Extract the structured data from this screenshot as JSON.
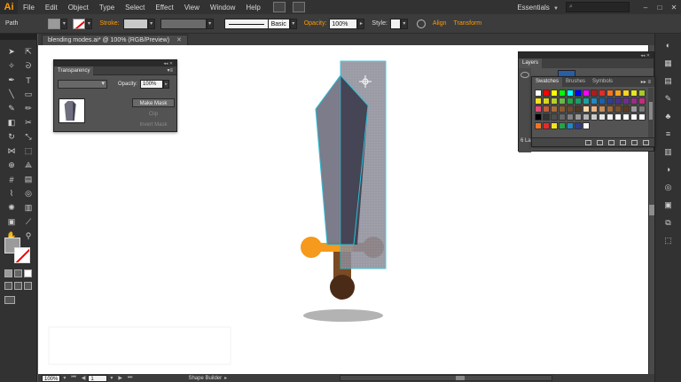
{
  "app": {
    "logo": "Ai"
  },
  "menu": {
    "items": [
      "File",
      "Edit",
      "Object",
      "Type",
      "Select",
      "Effect",
      "View",
      "Window",
      "Help"
    ]
  },
  "topbar": {
    "workspace": "Essentials",
    "search_placeholder": ""
  },
  "control_bar": {
    "selection_label": "Path",
    "stroke_label": "Stroke:",
    "stroke_profile": "Basic",
    "opacity_label": "Opacity:",
    "opacity_value": "100%",
    "style_label": "Style:",
    "align_label": "Align",
    "transform_label": "Transform"
  },
  "document": {
    "tab_title": "blending modes.ai* @ 100% (RGB/Preview)"
  },
  "transparency_panel": {
    "title": "Transparency",
    "opacity_label": "Opacity:",
    "opacity_value": "100%",
    "make_mask_label": "Make Mask",
    "clip_label": "Clip",
    "invert_mask_label": "Invert Mask"
  },
  "layers_panel": {
    "title": "Layers",
    "count_label": "6 La"
  },
  "swatches_panel": {
    "tabs": [
      "Swatches",
      "Brushes",
      "Symbols"
    ]
  },
  "status_bar": {
    "zoom_value": "100%",
    "artboard_value": "1",
    "tool_name": "Shape Builder"
  },
  "colors": {
    "accent_orange": "#ff9a00",
    "blade_dark": "#454555",
    "blade_light": "#6e6e7e",
    "selection_cyan": "#2bc0d8",
    "guard_orange": "#f59a1c",
    "guard_brown": "#a3683a",
    "handle_brown": "#7a4a24",
    "pommel_dark": "#4a2b18",
    "shadow_gray": "#b3b3b3"
  },
  "swatches": [
    "#ffffff",
    "#ff0000",
    "#ffff00",
    "#00ff00",
    "#00ffff",
    "#0000ff",
    "#ff00ff",
    "#b01c1c",
    "#e52a2a",
    "#f4741f",
    "#f7a21d",
    "#fbd41f",
    "#e7e61d",
    "#a7c929",
    "#f3e31c",
    "#d9d718",
    "#b6cf2a",
    "#66b946",
    "#1ea54a",
    "#1a9b6b",
    "#1ca0a0",
    "#2187c7",
    "#1d5fa9",
    "#2c3f91",
    "#4b3090",
    "#6f2e8f",
    "#9a2b8b",
    "#c32b7d",
    "#e84a76",
    "#c25c3b",
    "#a86c3a",
    "#8b5a2f",
    "#6e4a2c",
    "#4f3925",
    "#fdd7a9",
    "#e9b587",
    "#c58e60",
    "#9e6a3d",
    "#7a4f2d",
    "#593a22",
    "#9b9b9b",
    "#7b7b7b",
    "#000000",
    "#333333",
    "#4d4d4d",
    "#666666",
    "#808080",
    "#999999",
    "#b3b3b3",
    "#cccccc",
    "#e6e6e6",
    "#f2f2f2",
    "#ffffff",
    "#ffffff",
    "#ffffff",
    "#ffffff"
  ],
  "swatches_row5": [
    "#f4741f",
    "#e52a2a",
    "#f3e31c",
    "#1ea54a",
    "#2187c7",
    "#2c3f91",
    "#ffffff"
  ]
}
